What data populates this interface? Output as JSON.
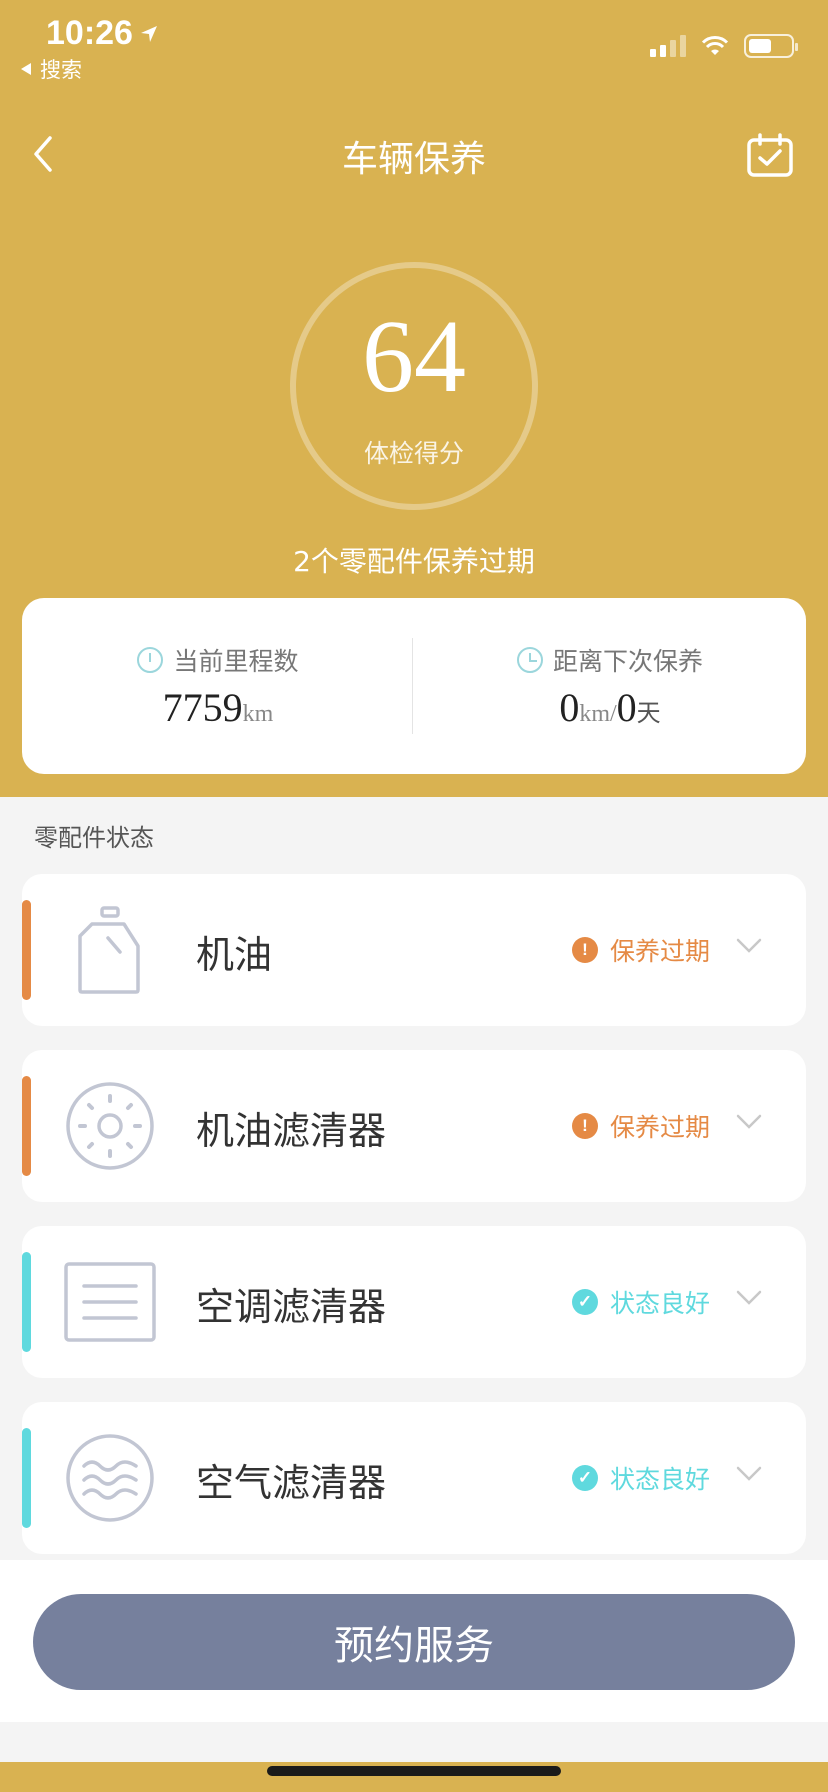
{
  "status_bar": {
    "time": "10:26",
    "back_app": "搜索"
  },
  "nav": {
    "title": "车辆保养"
  },
  "score": {
    "value": "64",
    "label": "体检得分",
    "note": "2个零配件保养过期"
  },
  "info": {
    "mileage": {
      "label": "当前里程数",
      "value": "7759",
      "unit": "km"
    },
    "next_service": {
      "label": "距离下次保养",
      "km_value": "0",
      "km_unit": "km",
      "separator": "/",
      "day_value": "0",
      "day_unit": "天"
    }
  },
  "section": {
    "title": "零配件状态"
  },
  "parts": [
    {
      "name": "机油",
      "status": "保养过期",
      "icon": "oil-bottle-icon"
    },
    {
      "name": "机油滤清器",
      "status": "保养过期",
      "icon": "oil-filter-icon"
    },
    {
      "name": "空调滤清器",
      "status": "状态良好",
      "icon": "ac-filter-icon"
    },
    {
      "name": "空气滤清器",
      "status": "状态良好",
      "icon": "air-filter-icon"
    }
  ],
  "colors": {
    "header": "#d9b251",
    "expired": "#e58a45",
    "good": "#5fd9de",
    "button": "#76809d"
  },
  "actions": {
    "book_label": "预约服务"
  }
}
